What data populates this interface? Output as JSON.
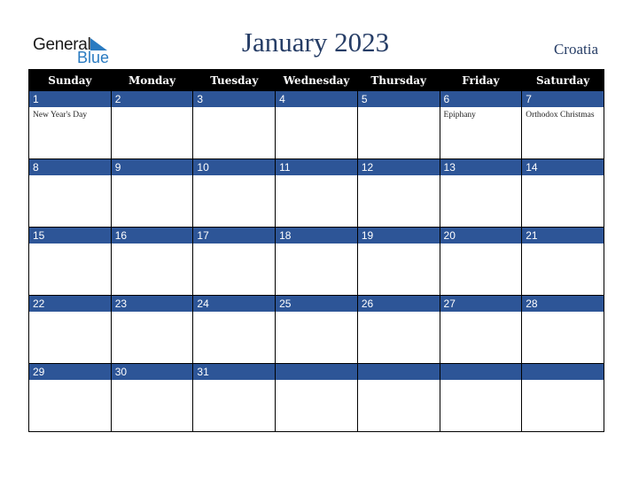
{
  "logo": {
    "line1": "General",
    "line2": "Blue",
    "accent_color": "#2a7bc1"
  },
  "header": {
    "title": "January 2023",
    "country": "Croatia"
  },
  "colors": {
    "header_bg": "#000000",
    "daybar_bg": "#2d5597",
    "title": "#263d66"
  },
  "weekdays": [
    "Sunday",
    "Monday",
    "Tuesday",
    "Wednesday",
    "Thursday",
    "Friday",
    "Saturday"
  ],
  "weeks": [
    [
      {
        "day": "1",
        "holiday": "New Year's Day"
      },
      {
        "day": "2",
        "holiday": ""
      },
      {
        "day": "3",
        "holiday": ""
      },
      {
        "day": "4",
        "holiday": ""
      },
      {
        "day": "5",
        "holiday": ""
      },
      {
        "day": "6",
        "holiday": "Epiphany"
      },
      {
        "day": "7",
        "holiday": "Orthodox Christmas"
      }
    ],
    [
      {
        "day": "8",
        "holiday": ""
      },
      {
        "day": "9",
        "holiday": ""
      },
      {
        "day": "10",
        "holiday": ""
      },
      {
        "day": "11",
        "holiday": ""
      },
      {
        "day": "12",
        "holiday": ""
      },
      {
        "day": "13",
        "holiday": ""
      },
      {
        "day": "14",
        "holiday": ""
      }
    ],
    [
      {
        "day": "15",
        "holiday": ""
      },
      {
        "day": "16",
        "holiday": ""
      },
      {
        "day": "17",
        "holiday": ""
      },
      {
        "day": "18",
        "holiday": ""
      },
      {
        "day": "19",
        "holiday": ""
      },
      {
        "day": "20",
        "holiday": ""
      },
      {
        "day": "21",
        "holiday": ""
      }
    ],
    [
      {
        "day": "22",
        "holiday": ""
      },
      {
        "day": "23",
        "holiday": ""
      },
      {
        "day": "24",
        "holiday": ""
      },
      {
        "day": "25",
        "holiday": ""
      },
      {
        "day": "26",
        "holiday": ""
      },
      {
        "day": "27",
        "holiday": ""
      },
      {
        "day": "28",
        "holiday": ""
      }
    ],
    [
      {
        "day": "29",
        "holiday": ""
      },
      {
        "day": "30",
        "holiday": ""
      },
      {
        "day": "31",
        "holiday": ""
      },
      {
        "day": "",
        "holiday": ""
      },
      {
        "day": "",
        "holiday": ""
      },
      {
        "day": "",
        "holiday": ""
      },
      {
        "day": "",
        "holiday": ""
      }
    ]
  ]
}
